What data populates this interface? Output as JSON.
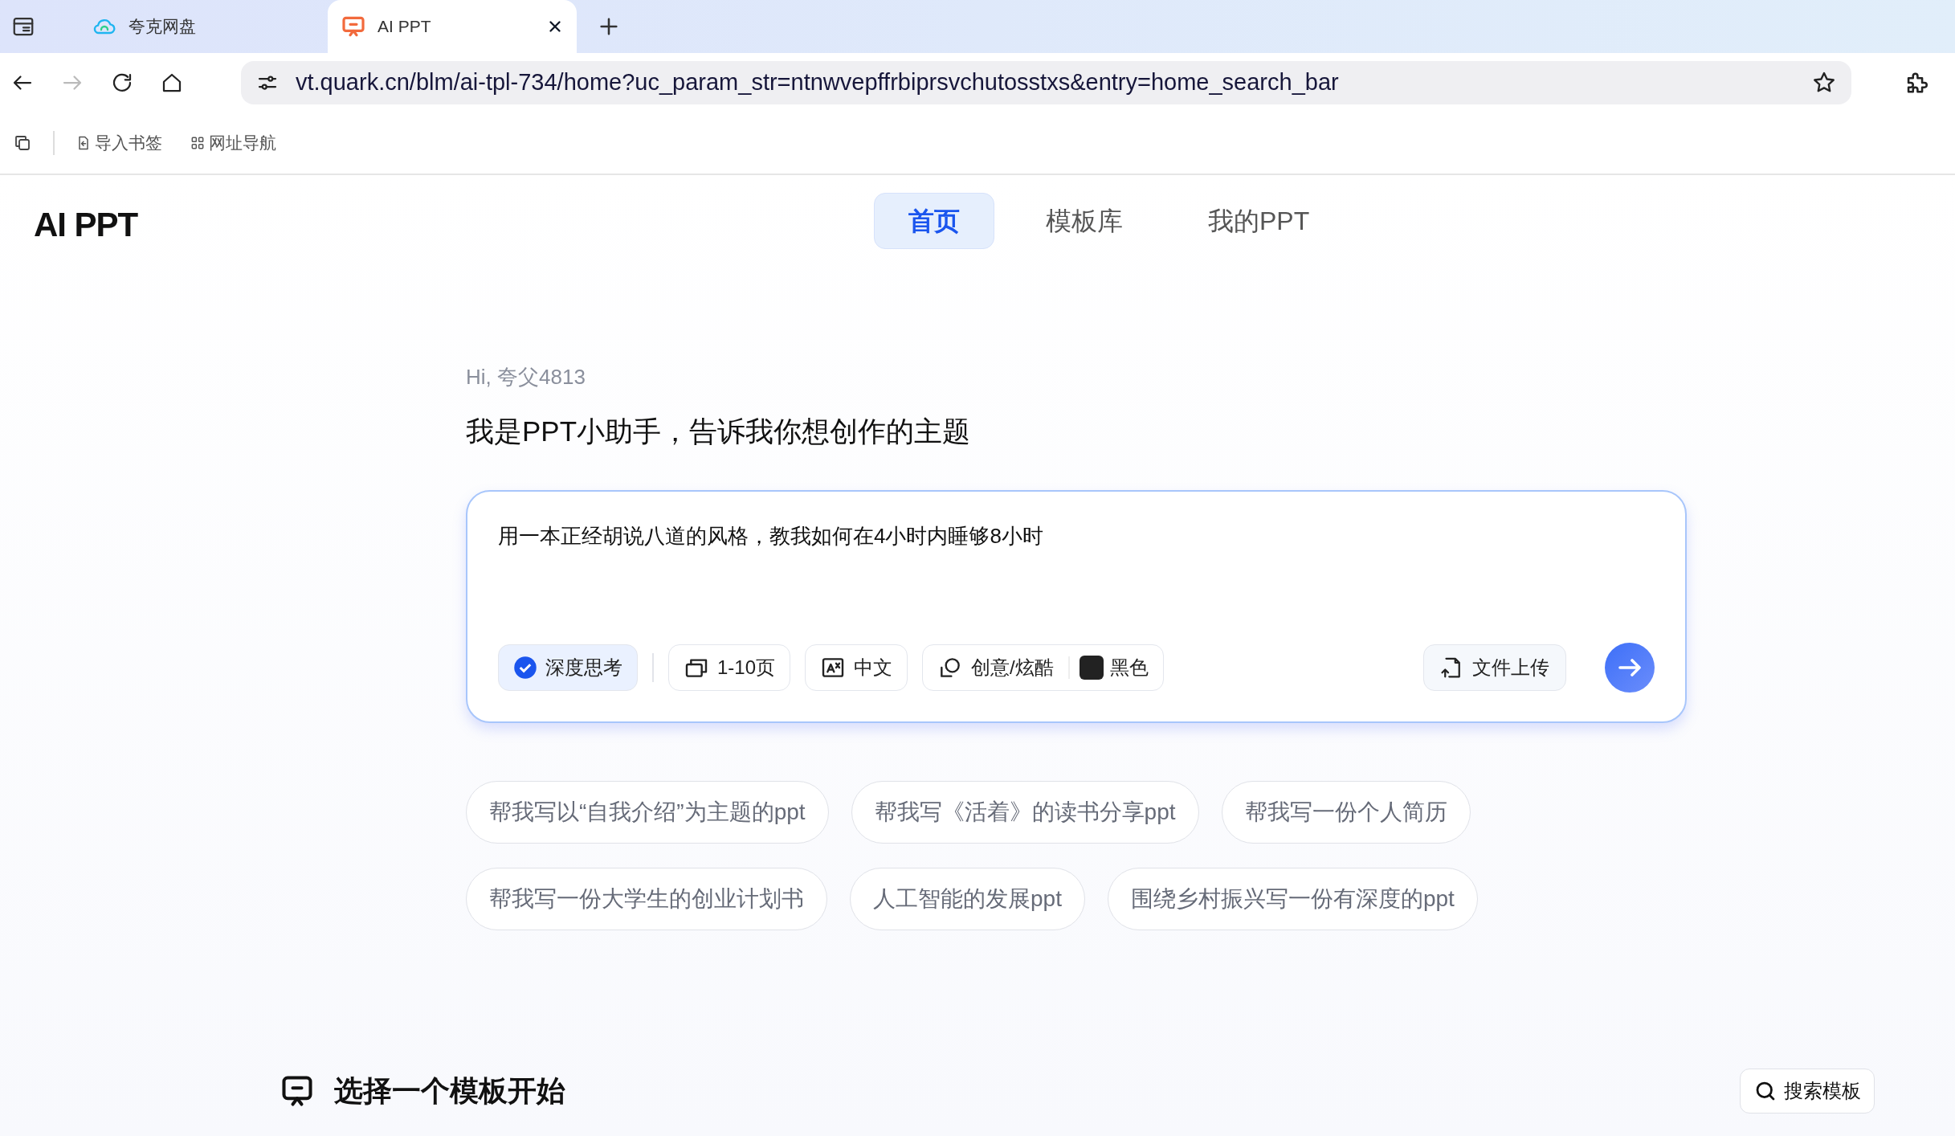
{
  "browser": {
    "tabs": [
      {
        "title": "夸克网盘",
        "kind": "cloud",
        "selected": false
      },
      {
        "title": "AI PPT",
        "kind": "ppt",
        "selected": true
      }
    ],
    "url": "vt.quark.cn/blm/ai-tpl-734/home?uc_param_str=ntnwvepffrbiprsvchutosstxs&entry=home_search_bar",
    "bookmarks": [
      {
        "label": "导入书签",
        "kind": "import"
      },
      {
        "label": "网址导航",
        "kind": "grid"
      }
    ]
  },
  "page": {
    "logo": "AI PPT",
    "nav": [
      {
        "label": "首页",
        "selected": true
      },
      {
        "label": "模板库",
        "selected": false
      },
      {
        "label": "我的PPT",
        "selected": false
      }
    ],
    "greeting": "Hi, 夸父4813",
    "heading": "我是PPT小助手，告诉我你想创作的主题",
    "prompt": {
      "value": "用一本正经胡说八道的风格，教我如何在4小时内睡够8小时"
    },
    "options": [
      {
        "kind": "toggle",
        "label": "深度思考",
        "on": true
      },
      {
        "kind": "pages",
        "label": "1-10页"
      },
      {
        "kind": "language",
        "label": "中文"
      },
      {
        "kind": "style",
        "label": "创意/炫酷",
        "color_label": "黑色",
        "color": "#222222"
      }
    ],
    "upload": "文件上传",
    "suggestions": [
      [
        "帮我写以“自我介绍”为主题的ppt",
        "帮我写《活着》的读书分享ppt",
        "帮我写一份个人简历"
      ],
      [
        "帮我写一份大学生的创业计划书",
        "人工智能的发展ppt",
        "围绕乡村振兴写一份有深度的ppt"
      ]
    ],
    "section_title": "选择一个模板开始",
    "search_button": "搜索模板"
  }
}
